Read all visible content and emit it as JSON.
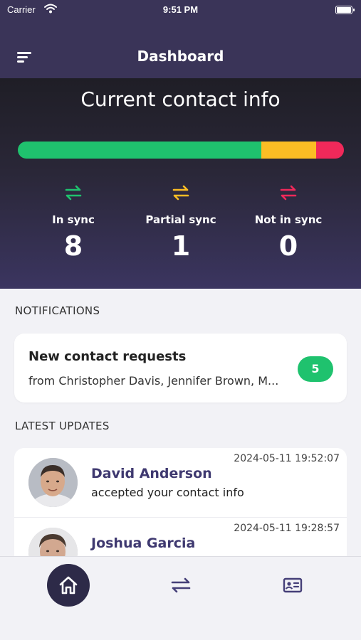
{
  "status_bar": {
    "carrier": "Carrier",
    "time": "9:51 PM"
  },
  "nav": {
    "title": "Dashboard",
    "menu_icon": "menu-icon"
  },
  "summary": {
    "title": "Current contact info",
    "bar": {
      "in_sync_fraction": 0.746,
      "partial_fraction": 0.168,
      "not_in_sync_fraction": 0.086
    },
    "colors": {
      "in_sync": "#1fc26e",
      "partial": "#fbbd24",
      "not_in_sync": "#f0295a"
    },
    "stats": [
      {
        "label": "In sync",
        "value": "8",
        "icon": "sync-icon",
        "color": "#1fc26e"
      },
      {
        "label": "Partial sync",
        "value": "1",
        "icon": "sync-icon",
        "color": "#fbbd24"
      },
      {
        "label": "Not in sync",
        "value": "0",
        "icon": "sync-icon",
        "color": "#f0295a"
      }
    ]
  },
  "notifications": {
    "heading": "NOTIFICATIONS",
    "card": {
      "title": "New contact requests",
      "subtitle": "from Christopher Davis, Jennifer Brown, M...",
      "badge": "5"
    }
  },
  "latest_updates": {
    "heading": "LATEST UPDATES",
    "items": [
      {
        "name": "David Anderson",
        "action": "accepted your contact info",
        "time": "2024-05-11 19:52:07"
      },
      {
        "name": "Joshua Garcia",
        "action": "",
        "time": "2024-05-11 19:28:57"
      }
    ]
  },
  "tab_bar": {
    "tabs": [
      {
        "icon": "home-icon",
        "active": true
      },
      {
        "icon": "sync-icon",
        "active": false
      },
      {
        "icon": "contact-card-icon",
        "active": false
      }
    ]
  }
}
